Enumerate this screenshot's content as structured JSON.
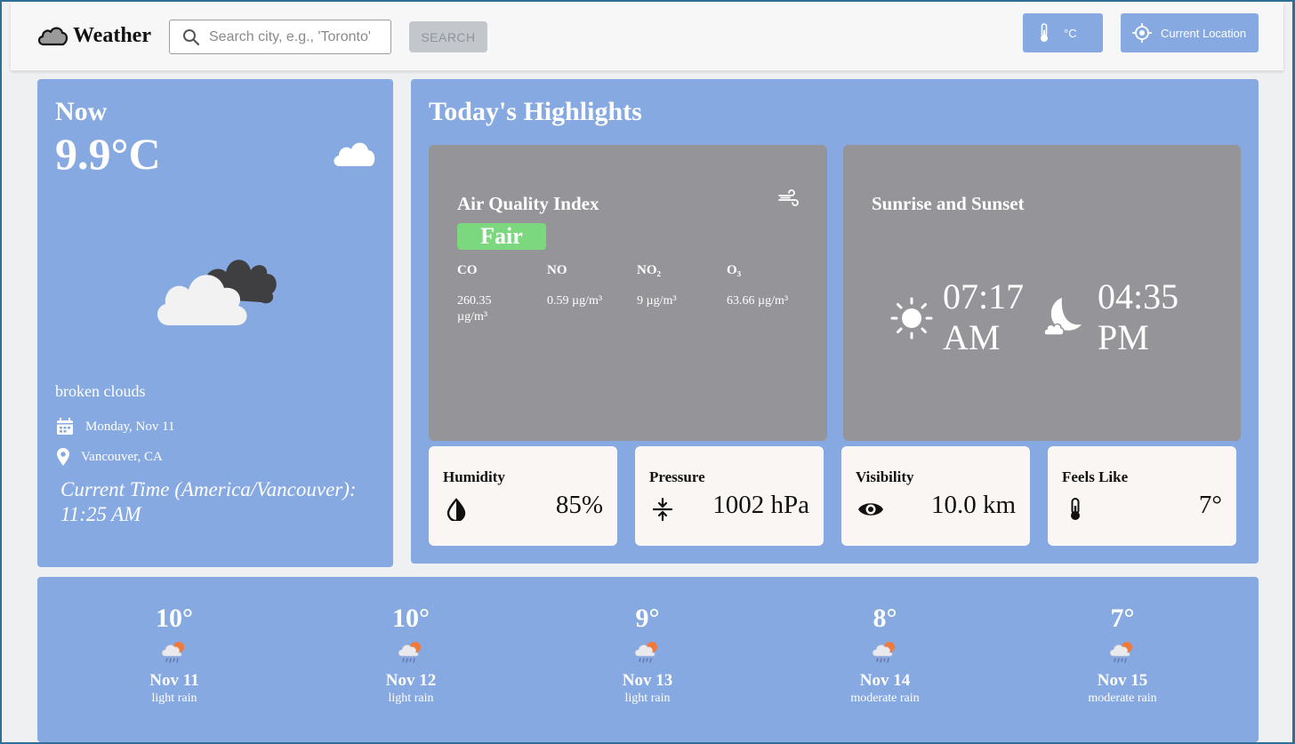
{
  "header": {
    "brand": "Weather",
    "search_placeholder": "Search city, e.g., 'Toronto'",
    "search_button": "SEARCH",
    "unit_button": "°C",
    "location_button": "Current Location"
  },
  "now": {
    "label": "Now",
    "temperature": "9.9°C",
    "description": "broken clouds",
    "date": "Monday, Nov 11",
    "location": "Vancouver, CA",
    "current_time": "Current Time (America/Vancouver): 11:25 AM"
  },
  "highlights": {
    "title": "Today's Highlights",
    "air_quality": {
      "title": "Air Quality Index",
      "rating": "Fair",
      "rating_color": "#7bd87e",
      "pollutants": [
        {
          "name": "CO",
          "value": "260.35 µg/m³"
        },
        {
          "name": "NO",
          "value": "0.59 µg/m³"
        },
        {
          "name": "NO₂",
          "value": "9 µg/m³"
        },
        {
          "name": "O₃",
          "value": "63.66 µg/m³"
        }
      ]
    },
    "sun": {
      "title": "Sunrise and Sunset",
      "sunrise": "07:17 AM",
      "sunset": "04:35 PM"
    },
    "stats": [
      {
        "title": "Humidity",
        "value": "85%",
        "icon": "humidity-icon"
      },
      {
        "title": "Pressure",
        "value": "1002 hPa",
        "icon": "pressure-icon"
      },
      {
        "title": "Visibility",
        "value": "10.0 km",
        "icon": "eye-icon"
      },
      {
        "title": "Feels Like",
        "value": "7°",
        "icon": "thermometer-icon"
      }
    ]
  },
  "forecast": [
    {
      "temp": "10°",
      "date": "Nov 11",
      "desc": "light rain",
      "icon": "rain-cloud-sun-icon"
    },
    {
      "temp": "10°",
      "date": "Nov 12",
      "desc": "light rain",
      "icon": "rain-cloud-sun-icon"
    },
    {
      "temp": "9°",
      "date": "Nov 13",
      "desc": "light rain",
      "icon": "rain-cloud-sun-icon"
    },
    {
      "temp": "8°",
      "date": "Nov 14",
      "desc": "moderate rain",
      "icon": "rain-cloud-sun-icon"
    },
    {
      "temp": "7°",
      "date": "Nov 15",
      "desc": "moderate rain",
      "icon": "rain-cloud-sun-icon"
    }
  ],
  "colors": {
    "panel": "#87a9e2",
    "card_grey": "#959599",
    "card_light": "#faf6f3",
    "border": "#2f6e97"
  }
}
